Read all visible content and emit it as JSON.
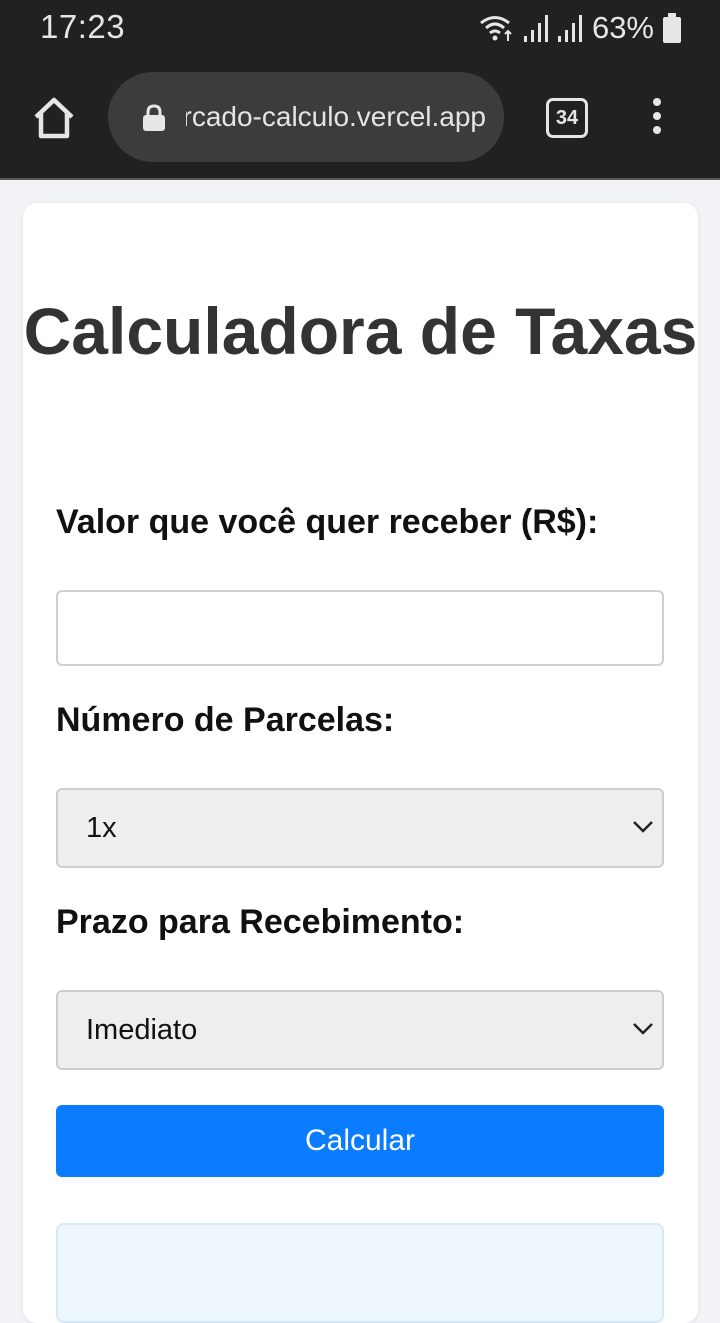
{
  "statusbar": {
    "time": "17:23",
    "battery_text": "63%",
    "icons": [
      "wifi-icon",
      "signal-icon",
      "signal-icon",
      "battery-icon"
    ]
  },
  "browser": {
    "url": "mercado-calculo.vercel.app",
    "tab_count": "34",
    "icons": [
      "home-icon",
      "lock-icon",
      "tabs-icon",
      "more-vert-icon"
    ]
  },
  "page": {
    "title": "Calculadora de Taxas",
    "amount_label": "Valor que você quer receber (R$):",
    "amount_value": "",
    "installments_label": "Número de Parcelas:",
    "installments_selected": "1x",
    "term_label": "Prazo para Recebimento:",
    "term_selected": "Imediato",
    "calculate_button": "Calcular"
  },
  "colors": {
    "primary": "#0a7cff",
    "chrome_bg": "#212121",
    "result_bg": "#eef7fd"
  }
}
